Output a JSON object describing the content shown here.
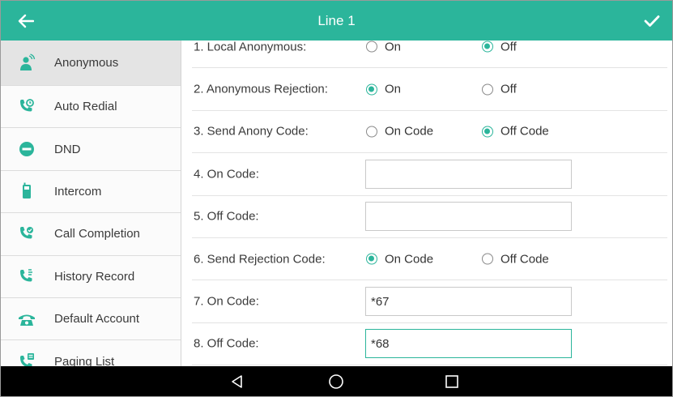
{
  "header": {
    "title": "Line 1",
    "back_icon": "arrow-left-icon",
    "confirm_icon": "checkmark-icon",
    "color": "#2bb59b"
  },
  "sidebar": {
    "items": [
      {
        "label": "Anonymous",
        "icon": "anonymous-person-icon",
        "active": true
      },
      {
        "label": "Auto Redial",
        "icon": "phone-redial-icon",
        "active": false
      },
      {
        "label": "DND",
        "icon": "do-not-disturb-icon",
        "active": false
      },
      {
        "label": "Intercom",
        "icon": "intercom-handset-icon",
        "active": false
      },
      {
        "label": "Call Completion",
        "icon": "call-completion-icon",
        "active": false
      },
      {
        "label": "History Record",
        "icon": "history-record-icon",
        "active": false
      },
      {
        "label": "Default Account",
        "icon": "telephone-icon",
        "active": false
      },
      {
        "label": "Paging List",
        "icon": "paging-list-icon",
        "active": false
      }
    ]
  },
  "settings": {
    "local_anonymous": {
      "label": "1. Local Anonymous:",
      "on": "On",
      "off": "Off",
      "selected": "Off"
    },
    "anonymous_rejection": {
      "label": "2. Anonymous Rejection:",
      "on": "On",
      "off": "Off",
      "selected": "On"
    },
    "send_anony_code": {
      "label": "3. Send Anony Code:",
      "on": "On Code",
      "off": "Off Code",
      "selected": "Off Code"
    },
    "anony_on_code": {
      "label": "4. On Code:",
      "value": ""
    },
    "anony_off_code": {
      "label": "5. Off Code:",
      "value": ""
    },
    "send_rejection_code": {
      "label": "6. Send Rejection Code:",
      "on": "On Code",
      "off": "Off Code",
      "selected": "On Code"
    },
    "rejection_on_code": {
      "label": "7. On Code:",
      "value": "*67"
    },
    "rejection_off_code": {
      "label": "8. Off Code:",
      "value": "*68"
    }
  },
  "navbar": {
    "back_icon": "nav-back-triangle-icon",
    "home_icon": "nav-home-circle-icon",
    "recents_icon": "nav-recents-square-icon"
  }
}
